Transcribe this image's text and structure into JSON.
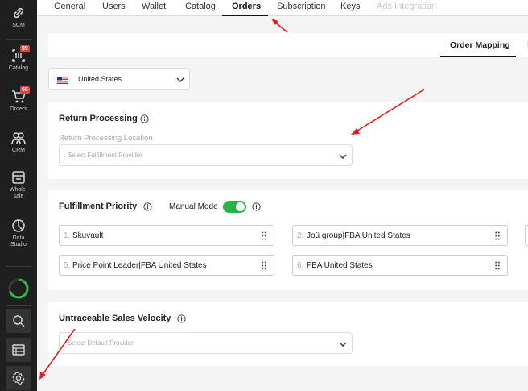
{
  "sidebar": {
    "items": [
      {
        "label": "SCM",
        "icon": "link-icon"
      },
      {
        "label": "Catalog",
        "icon": "barcode-icon",
        "badge": "99"
      },
      {
        "label": "Orders",
        "icon": "cart-icon",
        "badge": "66"
      },
      {
        "label": "CRM",
        "icon": "users-icon"
      },
      {
        "label": "Whole-\nsale",
        "icon": "store-icon"
      },
      {
        "label": "Data\nStudio",
        "icon": "pie-chart-icon"
      }
    ]
  },
  "tabs": [
    "General",
    "Users",
    "Wallet",
    "Catalog",
    "Orders",
    "Subscription",
    "Keys",
    "Ads Integration"
  ],
  "order_mapping": {
    "label": "Order Mapping"
  },
  "country": {
    "value": "United States"
  },
  "return_processing": {
    "title": "Return Processing",
    "location_label": "Return Processing Location",
    "placeholder": "Select Fulfillment Provider"
  },
  "fulfillment_priority": {
    "title": "Fulfillment Priority",
    "mode_label": "Manual Mode",
    "manual_mode_on": true,
    "items": [
      {
        "num": "1.",
        "name": "Skuvault"
      },
      {
        "num": "2.",
        "name": "Joü group|FBA United States"
      },
      {
        "num": "5.",
        "name": "Price Point Leader|FBA United States"
      },
      {
        "num": "6.",
        "name": "FBA United States"
      }
    ]
  },
  "sales_velocity": {
    "title": "Untraceable Sales Velocity",
    "placeholder": "Select Default Provider"
  },
  "colors": {
    "accent": "#27b345",
    "badge": "#e5463a",
    "annotation": "#e02020"
  }
}
